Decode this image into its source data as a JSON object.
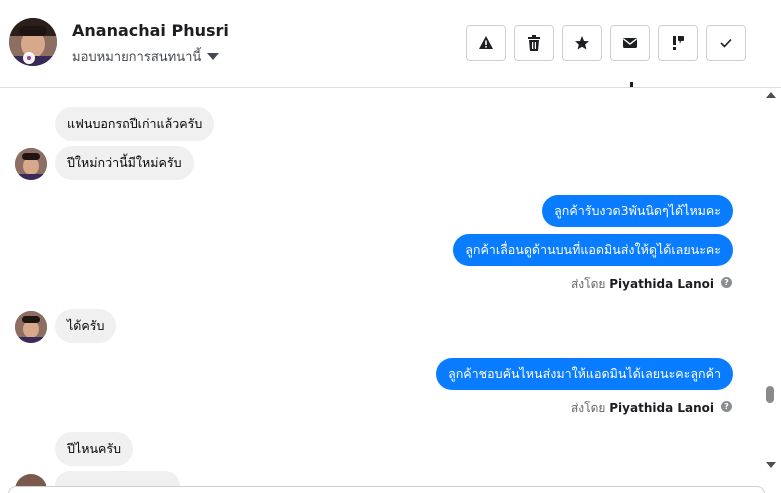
{
  "header": {
    "contact_name": "Ananachai Phusri",
    "assign_label": "มอบหมายการสนทนานี้",
    "actions": [
      {
        "icon": "warning-icon"
      },
      {
        "icon": "trash-icon"
      },
      {
        "icon": "star-icon"
      },
      {
        "icon": "envelope-icon"
      },
      {
        "icon": "follow-up-icon"
      },
      {
        "icon": "check-icon"
      }
    ]
  },
  "messages": [
    {
      "direction": "in",
      "text": "แฟนบอกรถปีเก่าแล้วครับ"
    },
    {
      "direction": "in",
      "text": "ปีใหม่กว่านี้มีใหม่ครับ"
    },
    {
      "direction": "out",
      "text": "ลูกค้ารับงวด3พันนิดๆได้ไหมคะ"
    },
    {
      "direction": "out",
      "text": "ลูกค้าเลื่อนดูด้านบนที่แอดมินส่งให้ดูได้เลยนะคะ"
    },
    {
      "direction": "in",
      "text": "ได้ครับ"
    },
    {
      "direction": "out",
      "text": "ลูกค้าชอบคันไหนส่งมาให้แอดมินได้เลยนะคะลูกค้า"
    },
    {
      "direction": "in",
      "text": "ปีไหนครับ"
    }
  ],
  "sent_by": {
    "prefix": "ส่งโดย",
    "name": "Piyathida Lanoi",
    "help_glyph": "?"
  },
  "colors": {
    "outgoing_bubble": "#0a7cff",
    "incoming_bubble": "#f0f0f0"
  }
}
